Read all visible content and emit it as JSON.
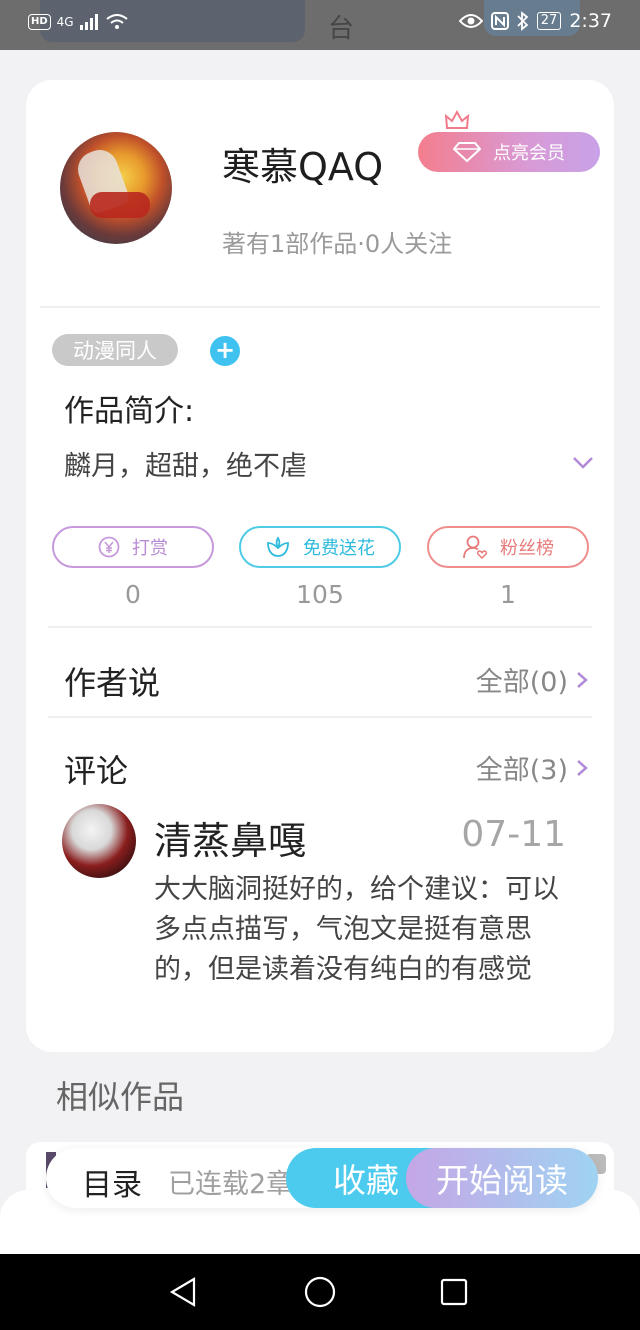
{
  "status_bar": {
    "left_badge": "HD",
    "network": "4G",
    "battery": "27",
    "time": "2:37",
    "peek_text": "台"
  },
  "author": {
    "name": "寒慕QAQ",
    "meta": "著有1部作品·0人关注",
    "vip_label": "点亮会员"
  },
  "tags": [
    "动漫同人"
  ],
  "intro": {
    "label": "作品简介:",
    "text": "麟月，超甜，绝不虐"
  },
  "actions": [
    {
      "label": "打赏",
      "count": "0",
      "color": "#c698dc"
    },
    {
      "label": "免费送花",
      "count": "105",
      "color": "#4fcbe6"
    },
    {
      "label": "粉丝榜",
      "count": "1",
      "color": "#ef8d8d"
    }
  ],
  "author_says": {
    "title": "作者说",
    "link": "全部(0)"
  },
  "comments": {
    "title": "评论",
    "link": "全部(3)",
    "items": [
      {
        "user": "清蒸鼻嘎",
        "date": "07-11",
        "text": "大大脑洞挺好的，给个建议：可以多点点描写，气泡文是挺有意思的，但是读着没有纯白的有感觉"
      }
    ]
  },
  "similar": {
    "title": "相似作品"
  },
  "bottom_bar": {
    "toc": "目录",
    "serial": "已连载2章",
    "favorite": "收藏",
    "start_reading": "开始阅读"
  }
}
